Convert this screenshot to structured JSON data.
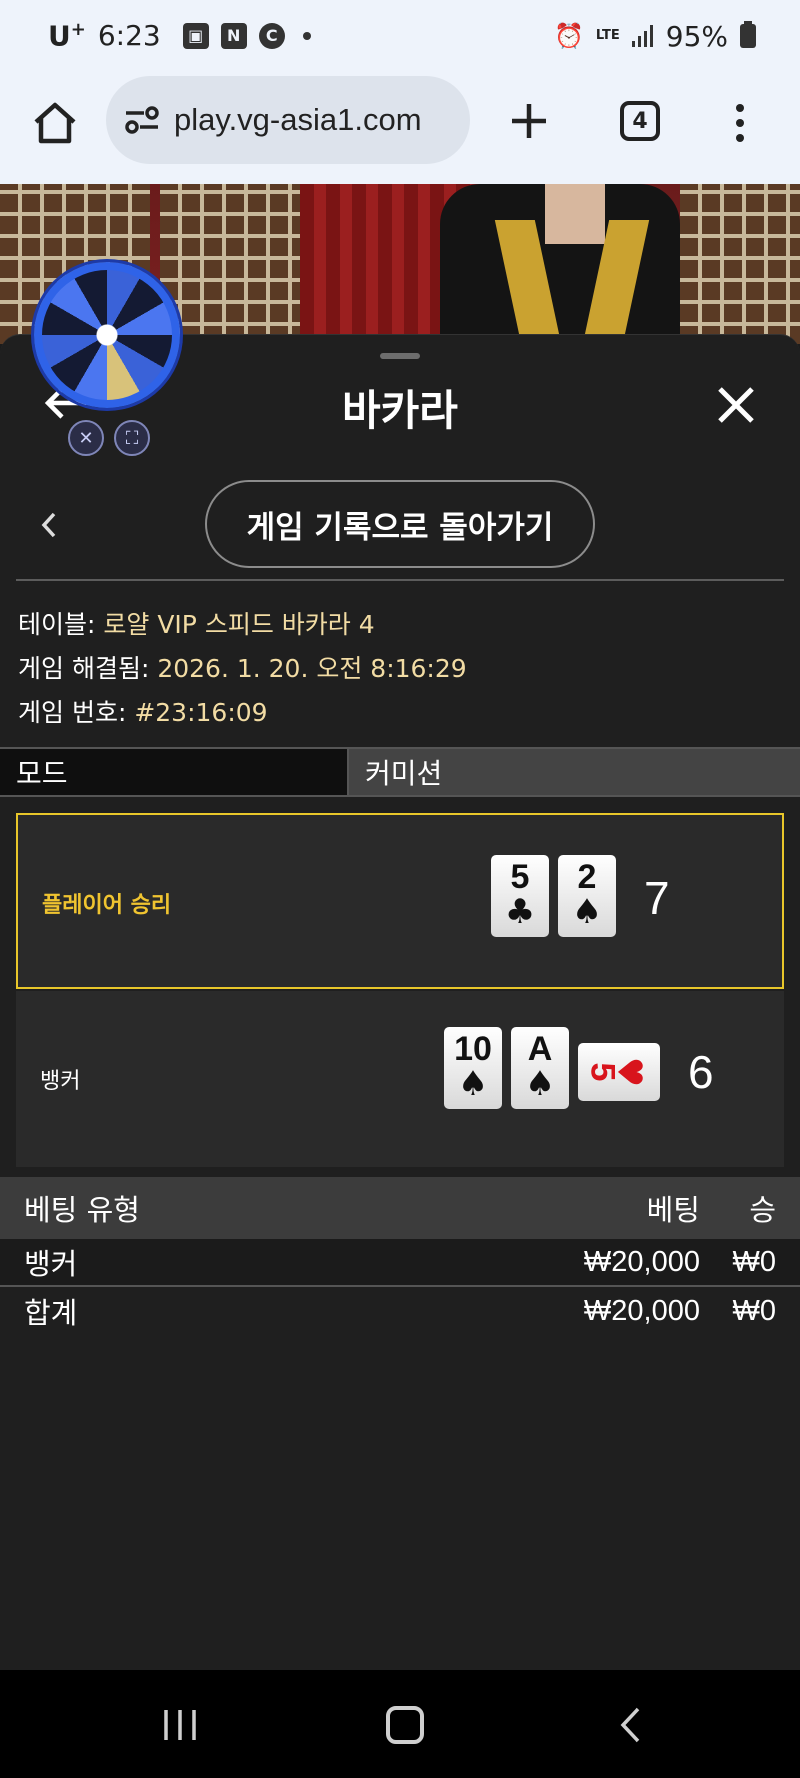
{
  "status_bar": {
    "carrier": "U",
    "carrier_sup": "+",
    "time": "6:23",
    "battery": "95%",
    "network": "LTE"
  },
  "browser": {
    "url": "play.vg-asia1.com",
    "tab_count": "4"
  },
  "sheet": {
    "title": "바카라",
    "history_button": "게임 기록으로 돌아가기"
  },
  "info": {
    "table_label": "테이블: ",
    "table_value": "로얄 VIP 스피드 바카라 4",
    "resolved_label": "게임 해결됨: ",
    "resolved_value": "2026. 1. 20. 오전 8:16:29",
    "number_label": "게임 번호: ",
    "number_value": "#23:16:09"
  },
  "mode_row": {
    "mode_label": "모드",
    "commission_label": "커미션"
  },
  "player_hand": {
    "label": "플레이어 승리",
    "score": "7",
    "cards": [
      {
        "rank": "5",
        "suit": "♣"
      },
      {
        "rank": "2",
        "suit": "♠"
      }
    ]
  },
  "banker_hand": {
    "label": "뱅커",
    "score": "6",
    "cards": [
      {
        "rank": "10",
        "suit": "♠"
      },
      {
        "rank": "A",
        "suit": "♠"
      },
      {
        "rank": "5",
        "suit": "♥"
      }
    ]
  },
  "bet_table": {
    "headers": {
      "type": "베팅 유형",
      "bet": "베팅",
      "win": "승"
    },
    "rows": [
      {
        "type": "뱅커",
        "bet": "₩20,000",
        "win": "₩0"
      }
    ],
    "total": {
      "type": "합계",
      "bet": "₩20,000",
      "win": "₩0"
    }
  },
  "colors": {
    "winner_border": "#e8c62a",
    "value_text": "#f2dca4",
    "red_suit": "#d8141c"
  }
}
